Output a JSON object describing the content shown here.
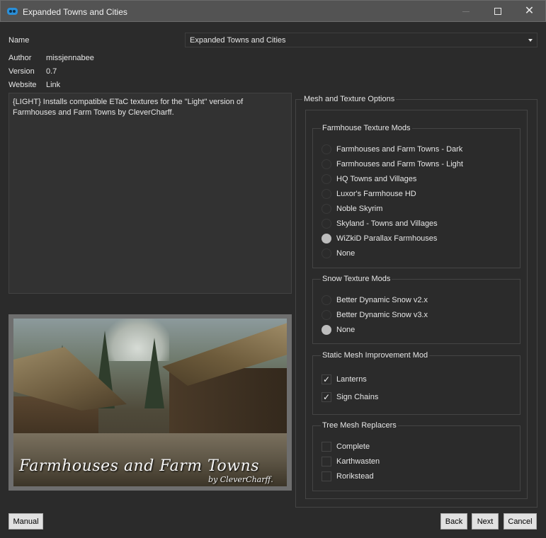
{
  "window": {
    "title": "Expanded Towns and Cities",
    "close_glyph": "✕"
  },
  "info": {
    "name_label": "Name",
    "name_value": "Expanded Towns and Cities",
    "author_label": "Author",
    "author_value": "missjennabee",
    "version_label": "Version",
    "version_value": "0.7",
    "website_label": "Website",
    "website_value": "Link"
  },
  "description": "{LIGHT} Installs compatible ETaC textures for the \"Light\" version of Farmhouses and Farm Towns by CleverCharff.",
  "image": {
    "caption": "Farmhouses and Farm Towns",
    "credit": "by CleverCharff."
  },
  "options": {
    "title": "Mesh and Texture Options",
    "groups": [
      {
        "title": "Farmhouse Texture Mods",
        "type": "radio",
        "items": [
          {
            "label": "Farmhouses and Farm Towns - Dark",
            "selected": false
          },
          {
            "label": "Farmhouses and Farm Towns - Light",
            "selected": false
          },
          {
            "label": "HQ Towns and Villages",
            "selected": false
          },
          {
            "label": "Luxor's Farmhouse HD",
            "selected": false
          },
          {
            "label": "Noble Skyrim",
            "selected": false
          },
          {
            "label": "Skyland - Towns and Villages",
            "selected": false
          },
          {
            "label": "WiZkiD Parallax Farmhouses",
            "selected": true
          },
          {
            "label": "None",
            "selected": false
          }
        ]
      },
      {
        "title": "Snow Texture Mods",
        "type": "radio",
        "items": [
          {
            "label": "Better Dynamic Snow v2.x",
            "selected": false
          },
          {
            "label": "Better Dynamic Snow v3.x",
            "selected": false
          },
          {
            "label": "None",
            "selected": true
          }
        ]
      },
      {
        "title": "Static Mesh Improvement Mod",
        "type": "checkbox",
        "items": [
          {
            "label": "Lanterns",
            "checked": true,
            "mark": "✓"
          },
          {
            "label": "Sign Chains",
            "checked": true,
            "mark": "✓"
          }
        ]
      },
      {
        "title": "Tree Mesh Replacers",
        "type": "checkbox",
        "items": [
          {
            "label": "Complete",
            "checked": false,
            "mark": ""
          },
          {
            "label": "Karthwasten",
            "checked": false,
            "mark": ""
          },
          {
            "label": "Rorikstead",
            "checked": false,
            "mark": ""
          }
        ]
      }
    ]
  },
  "buttons": {
    "manual": "Manual",
    "back": "Back",
    "next": "Next",
    "cancel": "Cancel"
  }
}
